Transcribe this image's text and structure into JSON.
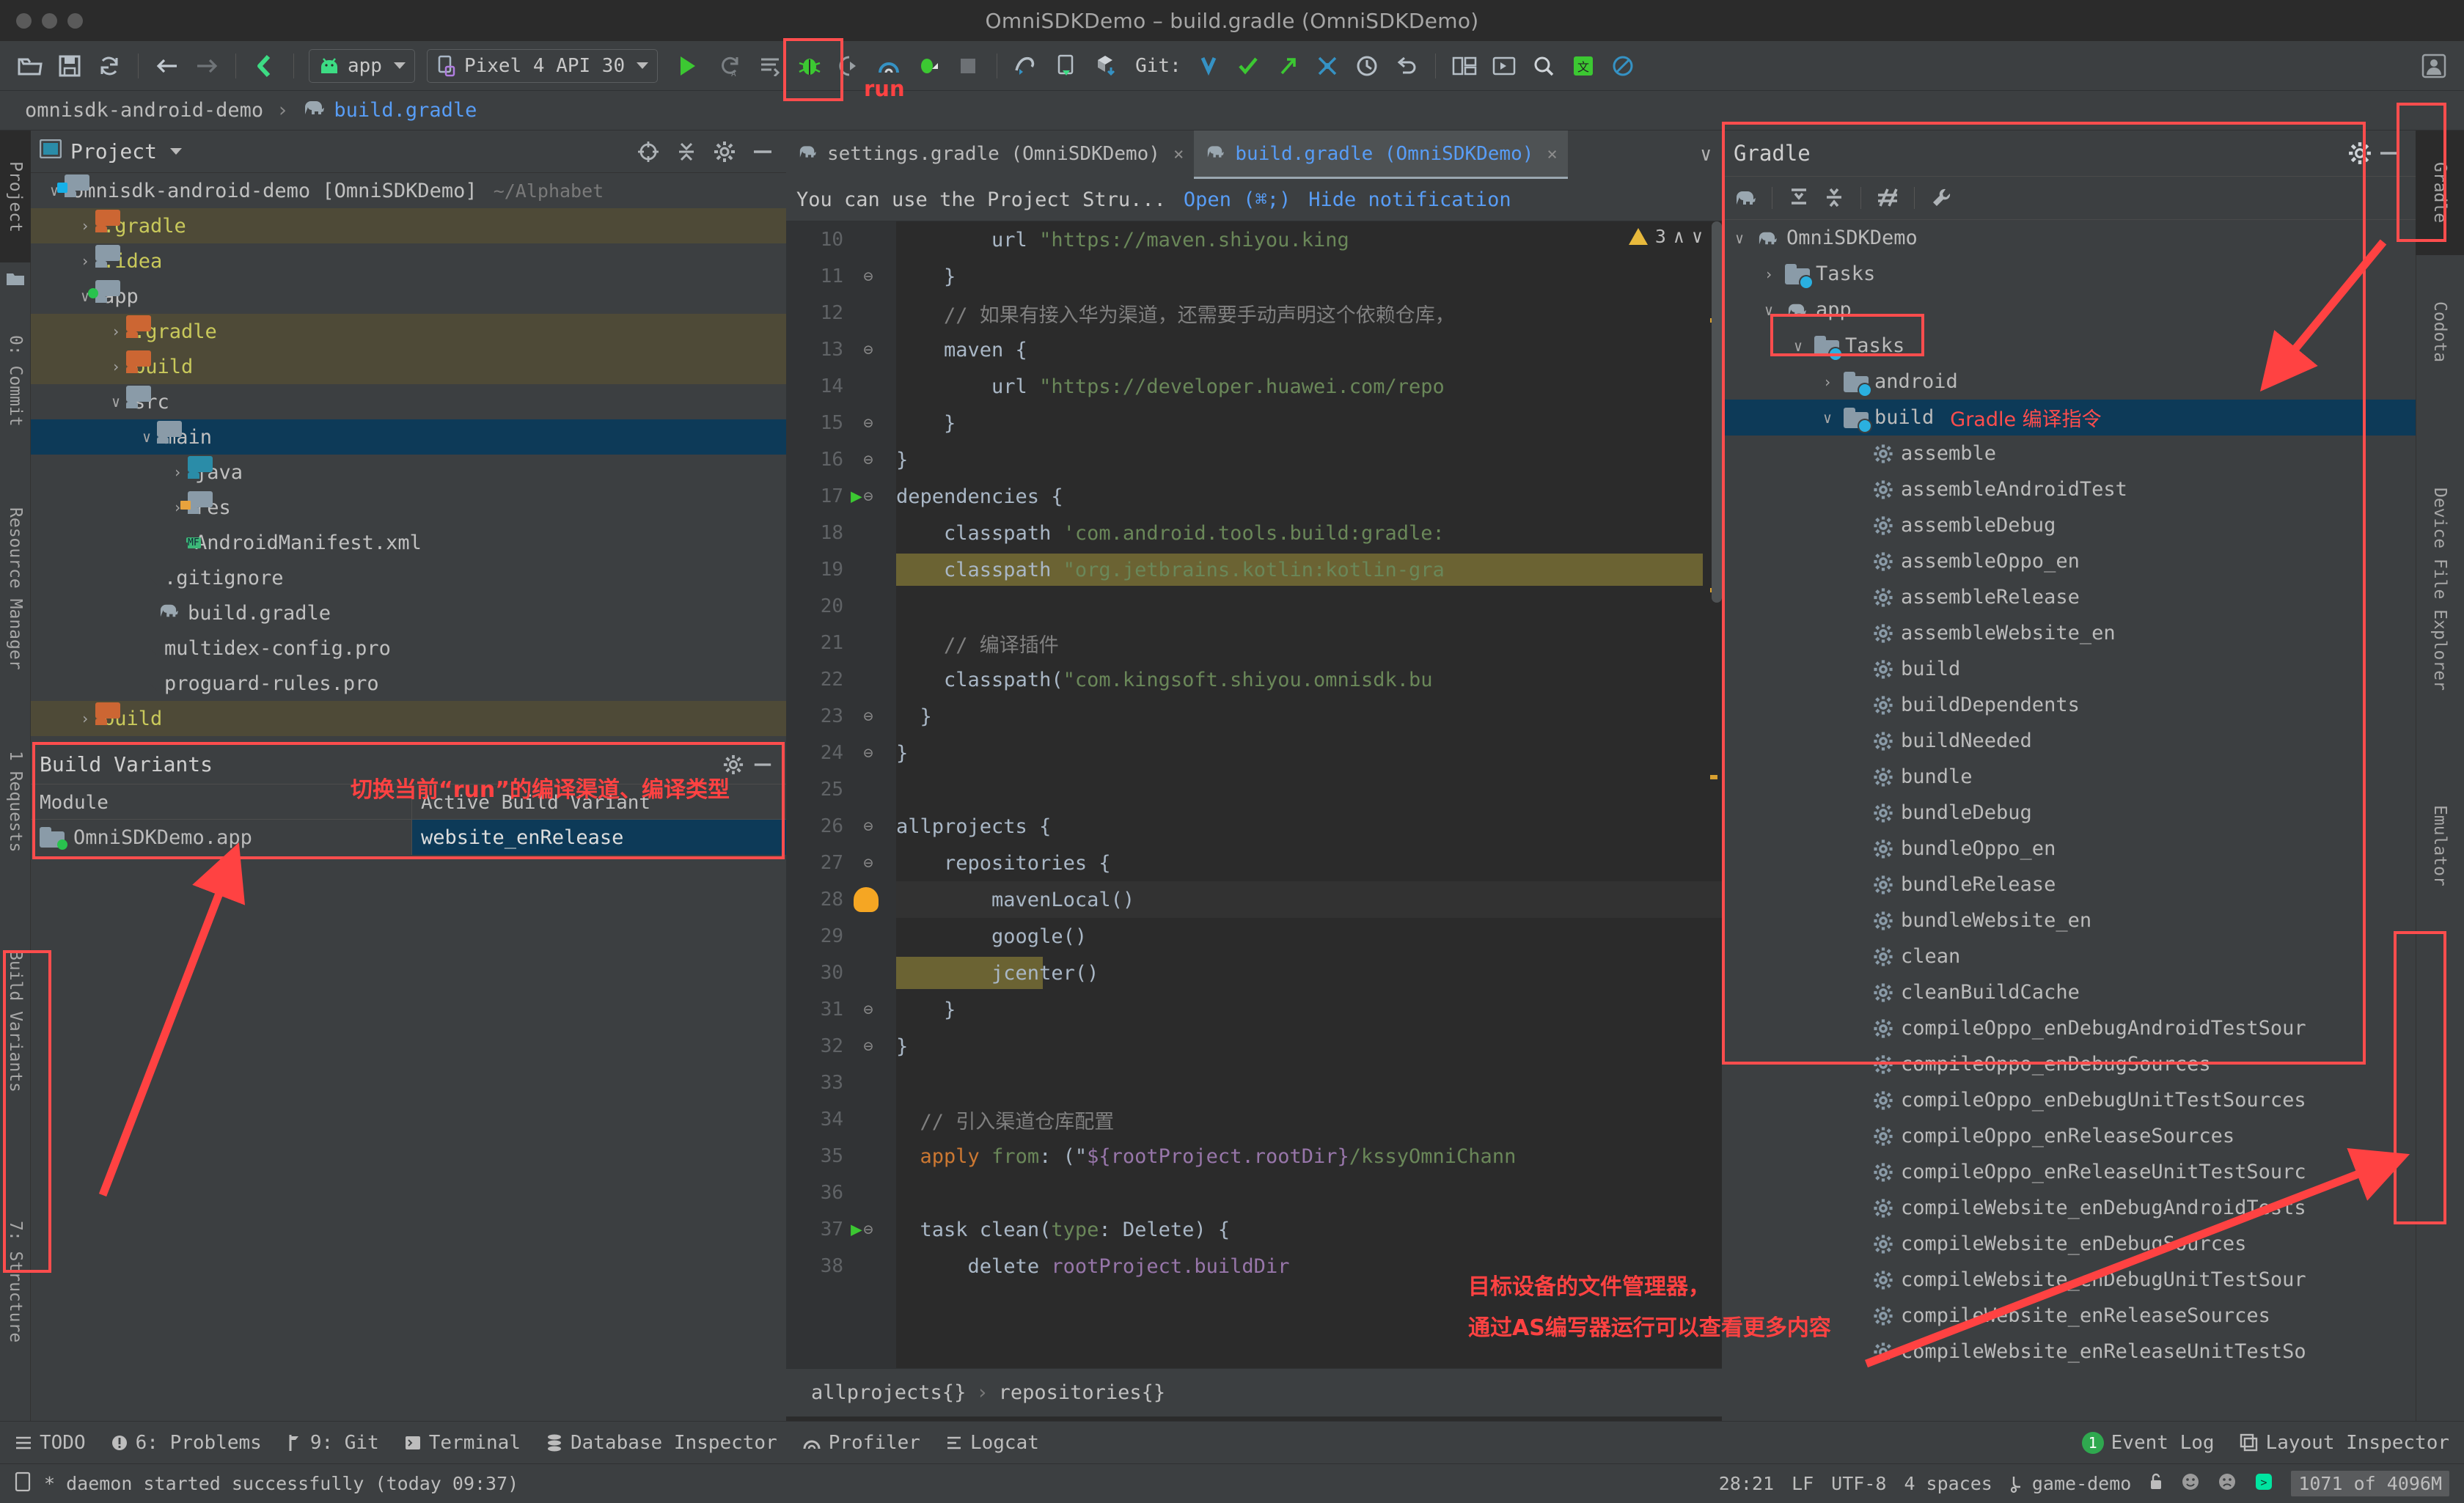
{
  "window": {
    "title": "OmniSDKDemo – build.gradle (OmniSDKDemo)"
  },
  "toolbar": {
    "module_selector": "app",
    "device_selector": "Pixel 4 API 30",
    "git_label": "Git:",
    "icons": [
      "open-folder-icon",
      "save-all-icon",
      "sync-project-icon",
      "back-icon",
      "forward-icon",
      "android-sdk-manager-icon",
      "run-icon",
      "rerun-icon",
      "apply-changes-icon",
      "debug-icon",
      "coverage-icon",
      "profile-icon",
      "attach-debugger-icon",
      "stop-icon",
      "avd-manager-icon",
      "device-manager-icon",
      "sdk-download-icon",
      "update-project-icon",
      "commit-icon",
      "push-icon",
      "rollback-icon",
      "history-icon",
      "undo-icon",
      "layout-editor-icon",
      "preview-icon",
      "search-icon",
      "translate-icon",
      "no-entry-icon"
    ]
  },
  "breadcrumb": {
    "root": "omnisdk-android-demo",
    "separator": "›",
    "file": "build.gradle"
  },
  "left_strip": {
    "tabs": [
      "Project",
      "0: Commit",
      "Resource Manager",
      "1 Requests",
      "Build Variants",
      "7: Structure"
    ]
  },
  "project_panel": {
    "title": "Project",
    "tree": [
      {
        "label": "omnisdk-android-demo [OmniSDKDemo]",
        "path": "~/Alphabet",
        "depth": 0,
        "arrow": "down",
        "icon": "folder-module",
        "state": "normal",
        "color": "plain"
      },
      {
        "label": ".gradle",
        "depth": 1,
        "arrow": "right",
        "icon": "folder-excluded",
        "state": "hl",
        "color": "yellow"
      },
      {
        "label": ".idea",
        "depth": 1,
        "arrow": "right",
        "icon": "folder",
        "state": "normal",
        "color": "yellow"
      },
      {
        "label": "app",
        "depth": 1,
        "arrow": "down",
        "icon": "folder-module-green",
        "state": "normal",
        "color": "plain"
      },
      {
        "label": ".gradle",
        "depth": 2,
        "arrow": "right",
        "icon": "folder-excluded",
        "state": "hl",
        "color": "yellow"
      },
      {
        "label": "build",
        "depth": 2,
        "arrow": "right",
        "icon": "folder-excluded",
        "state": "hl",
        "color": "yellow"
      },
      {
        "label": "src",
        "depth": 2,
        "arrow": "down",
        "icon": "folder",
        "state": "normal",
        "color": "plain"
      },
      {
        "label": "main",
        "depth": 3,
        "arrow": "down",
        "icon": "folder",
        "state": "sel",
        "color": "plain"
      },
      {
        "label": "java",
        "depth": 4,
        "arrow": "right",
        "icon": "folder-source",
        "state": "normal",
        "color": "plain"
      },
      {
        "label": "res",
        "depth": 4,
        "arrow": "right",
        "icon": "folder-res",
        "state": "normal",
        "color": "plain"
      },
      {
        "label": "AndroidManifest.xml",
        "depth": 4,
        "arrow": "none",
        "icon": "manifest-file",
        "state": "normal",
        "color": "plain"
      },
      {
        "label": ".gitignore",
        "depth": 3,
        "arrow": "none",
        "icon": "gitignore-file",
        "state": "normal",
        "color": "plain"
      },
      {
        "label": "build.gradle",
        "depth": 3,
        "arrow": "none",
        "icon": "gradle-file",
        "state": "normal",
        "color": "plain"
      },
      {
        "label": "multidex-config.pro",
        "depth": 3,
        "arrow": "none",
        "icon": "text-file",
        "state": "normal",
        "color": "plain"
      },
      {
        "label": "proguard-rules.pro",
        "depth": 3,
        "arrow": "none",
        "icon": "text-file",
        "state": "normal",
        "color": "plain"
      },
      {
        "label": "build",
        "depth": 1,
        "arrow": "right",
        "icon": "folder-excluded",
        "state": "hl",
        "color": "yellow"
      }
    ]
  },
  "build_variants": {
    "title": "Build Variants",
    "columns": [
      "Module",
      "Active Build Variant"
    ],
    "rows": [
      {
        "module": "OmniSDKDemo.app",
        "variant": "website_enRelease"
      }
    ]
  },
  "editor": {
    "tabs": [
      {
        "label": "settings.gradle (OmniSDKDemo)",
        "active": false,
        "close": "×"
      },
      {
        "label": "build.gradle (OmniSDKDemo)",
        "active": true,
        "close": "×"
      }
    ],
    "notification": {
      "message": "You can use the Project Stru...",
      "action": "Open (⌘;)",
      "hide": "Hide notification"
    },
    "inspection": {
      "count": "3",
      "up": "∧",
      "down": "∨"
    },
    "lines": [
      {
        "n": "10",
        "text": "        url \"https://maven.shiyou.king",
        "kind": "url-line"
      },
      {
        "n": "11",
        "text": "    }",
        "fold": "end"
      },
      {
        "n": "12",
        "text": "    // 如果有接入华为渠道，还需要手动声明这个依赖仓库，",
        "kind": "comment"
      },
      {
        "n": "13",
        "text": "    maven {",
        "fold": "start"
      },
      {
        "n": "14",
        "text": "        url \"https://developer.huawei.com/repo",
        "kind": "url-line"
      },
      {
        "n": "15",
        "text": "    }",
        "fold": "end"
      },
      {
        "n": "16",
        "text": "}",
        "fold": "end"
      },
      {
        "n": "17",
        "text": "dependencies {",
        "fold": "start",
        "run": true
      },
      {
        "n": "18",
        "text": "    classpath 'com.android.tools.build:gradle:",
        "kind": "classpath"
      },
      {
        "n": "19",
        "text": "    classpath \"org.jetbrains.kotlin:kotlin-gra",
        "kind": "classpath",
        "highlight": true
      },
      {
        "n": "20",
        "text": ""
      },
      {
        "n": "21",
        "text": "    // 编译插件",
        "kind": "comment"
      },
      {
        "n": "22",
        "text": "    classpath(\"com.kingsoft.shiyou.omnisdk.bu",
        "kind": "classpath"
      },
      {
        "n": "23",
        "text": "  }",
        "fold": "end"
      },
      {
        "n": "24",
        "text": "}",
        "fold": "end"
      },
      {
        "n": "25",
        "text": ""
      },
      {
        "n": "26",
        "text": "allprojects {",
        "fold": "start"
      },
      {
        "n": "27",
        "text": "    repositories {",
        "fold": "start"
      },
      {
        "n": "28",
        "text": "        mavenLocal()",
        "bulb": true,
        "caret": true
      },
      {
        "n": "29",
        "text": "        google()"
      },
      {
        "n": "30",
        "text": "        jcenter()",
        "highlight": true
      },
      {
        "n": "31",
        "text": "    }",
        "fold": "end"
      },
      {
        "n": "32",
        "text": "}",
        "fold": "end"
      },
      {
        "n": "33",
        "text": ""
      },
      {
        "n": "34",
        "text": "  // 引入渠道仓库配置",
        "kind": "comment"
      },
      {
        "n": "35",
        "text": "  apply from: (\"${rootProject.rootDir}/kssyOmniChann",
        "kind": "apply"
      },
      {
        "n": "36",
        "text": ""
      },
      {
        "n": "37",
        "text": "  task clean(type: Delete) {",
        "fold": "start",
        "run": true,
        "kind": "task"
      },
      {
        "n": "38",
        "text": "      delete rootProject.buildDir",
        "kind": "delete"
      }
    ],
    "breadcrumb": [
      "allprojects{}",
      "repositories{}"
    ]
  },
  "gradle_panel": {
    "title": "Gradle",
    "tree": [
      {
        "label": "OmniSDKDemo",
        "depth": 0,
        "arrow": "down",
        "icon": "gradle-elephant-icon"
      },
      {
        "label": "Tasks",
        "depth": 1,
        "arrow": "right",
        "icon": "tasks-folder-icon"
      },
      {
        "label": "app",
        "depth": 1,
        "arrow": "down",
        "icon": "gradle-elephant-icon",
        "boxed": true
      },
      {
        "label": "Tasks",
        "depth": 2,
        "arrow": "down",
        "icon": "tasks-folder-icon"
      },
      {
        "label": "android",
        "depth": 3,
        "arrow": "right",
        "icon": "tasks-folder-icon"
      },
      {
        "label": "build",
        "depth": 3,
        "arrow": "down",
        "icon": "tasks-folder-icon",
        "selected": true,
        "annotation": "Gradle 编译指令"
      },
      {
        "label": "assemble",
        "depth": 4,
        "icon": "gear-icon"
      },
      {
        "label": "assembleAndroidTest",
        "depth": 4,
        "icon": "gear-icon"
      },
      {
        "label": "assembleDebug",
        "depth": 4,
        "icon": "gear-icon"
      },
      {
        "label": "assembleOppo_en",
        "depth": 4,
        "icon": "gear-icon"
      },
      {
        "label": "assembleRelease",
        "depth": 4,
        "icon": "gear-icon"
      },
      {
        "label": "assembleWebsite_en",
        "depth": 4,
        "icon": "gear-icon"
      },
      {
        "label": "build",
        "depth": 4,
        "icon": "gear-icon"
      },
      {
        "label": "buildDependents",
        "depth": 4,
        "icon": "gear-icon"
      },
      {
        "label": "buildNeeded",
        "depth": 4,
        "icon": "gear-icon"
      },
      {
        "label": "bundle",
        "depth": 4,
        "icon": "gear-icon"
      },
      {
        "label": "bundleDebug",
        "depth": 4,
        "icon": "gear-icon"
      },
      {
        "label": "bundleOppo_en",
        "depth": 4,
        "icon": "gear-icon"
      },
      {
        "label": "bundleRelease",
        "depth": 4,
        "icon": "gear-icon"
      },
      {
        "label": "bundleWebsite_en",
        "depth": 4,
        "icon": "gear-icon"
      },
      {
        "label": "clean",
        "depth": 4,
        "icon": "gear-icon"
      },
      {
        "label": "cleanBuildCache",
        "depth": 4,
        "icon": "gear-icon"
      },
      {
        "label": "compileOppo_enDebugAndroidTestSour",
        "depth": 4,
        "icon": "gear-icon"
      },
      {
        "label": "compileOppo_enDebugSources",
        "depth": 4,
        "icon": "gear-icon"
      },
      {
        "label": "compileOppo_enDebugUnitTestSources",
        "depth": 4,
        "icon": "gear-icon"
      },
      {
        "label": "compileOppo_enReleaseSources",
        "depth": 4,
        "icon": "gear-icon"
      },
      {
        "label": "compileOppo_enReleaseUnitTestSourc",
        "depth": 4,
        "icon": "gear-icon"
      },
      {
        "label": "compileWebsite_enDebugAndroidTests",
        "depth": 4,
        "icon": "gear-icon"
      },
      {
        "label": "compileWebsite_enDebugSources",
        "depth": 4,
        "icon": "gear-icon"
      },
      {
        "label": "compileWebsite_enDebugUnitTestSour",
        "depth": 4,
        "icon": "gear-icon"
      },
      {
        "label": "compileWebsite_enReleaseSources",
        "depth": 4,
        "icon": "gear-icon"
      },
      {
        "label": "compileWebsite_enReleaseUnitTestSo",
        "depth": 4,
        "icon": "gear-icon"
      }
    ]
  },
  "right_strip": {
    "tabs": [
      "Gradle",
      "Codota",
      "Device File Explorer",
      "Emulator"
    ]
  },
  "tool_window_bar": {
    "items": [
      "TODO",
      "6: Problems",
      "9: Git",
      "Terminal",
      "Database Inspector",
      "Profiler",
      "Logcat"
    ],
    "right_items": [
      "Event Log",
      "Layout Inspector"
    ],
    "event_log_badge": "1"
  },
  "status_bar": {
    "message": "* daemon started successfully (today 09:37)",
    "caret": "28:21",
    "line_sep": "LF",
    "encoding": "UTF-8",
    "indent": "4 spaces",
    "branch": "game-demo",
    "memory": "1071 of 4096M"
  },
  "annotations": [
    {
      "id": "run-label",
      "text": "run"
    },
    {
      "id": "build-variants-note",
      "text": "切换当前“run”的编译渠道、编译类型"
    },
    {
      "id": "gradle-cmd-note",
      "text": "Gradle 编译指令"
    },
    {
      "id": "device-explorer-note-1",
      "text": "目标设备的文件管理器，"
    },
    {
      "id": "device-explorer-note-2",
      "text": "通过AS编写器运行可以查看更多内容"
    },
    {
      "id": "build-variants-side-label",
      "text": "Build Variants"
    }
  ],
  "colors": {
    "accent_blue": "#589df6",
    "selection": "#0d3a58",
    "excluded": "#4e4a37",
    "annotation_red": "#ff4242",
    "green_run": "#3cc832",
    "panel_bg": "#3c3f41",
    "editor_bg": "#2b2b2b"
  }
}
